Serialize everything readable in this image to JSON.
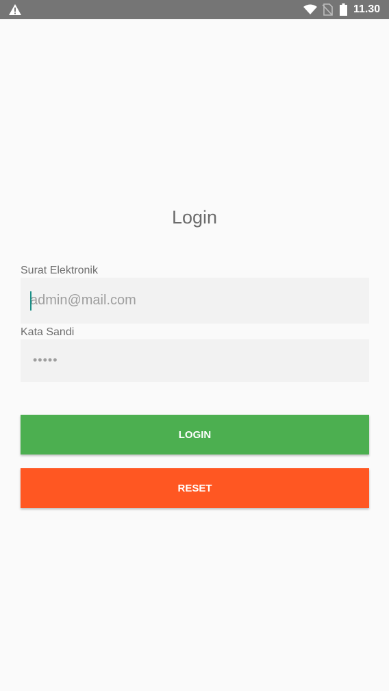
{
  "status_bar": {
    "time": "11.30",
    "icons": [
      "warning-icon",
      "wifi-icon",
      "no-sim-icon",
      "battery-icon"
    ],
    "background": "#757575"
  },
  "login": {
    "title": "Login",
    "email": {
      "label": "Surat Elektronik",
      "placeholder": "admin@mail.com",
      "value": ""
    },
    "password": {
      "label": "Kata Sandi",
      "value_masked": "•••••"
    },
    "login_button": {
      "label": "LOGIN",
      "color": "#4caf50"
    },
    "reset_button": {
      "label": "RESET",
      "color": "#ff5722"
    }
  },
  "colors": {
    "background": "#fafafa",
    "field_background": "#f2f2f2",
    "caret": "#1b8f87"
  }
}
